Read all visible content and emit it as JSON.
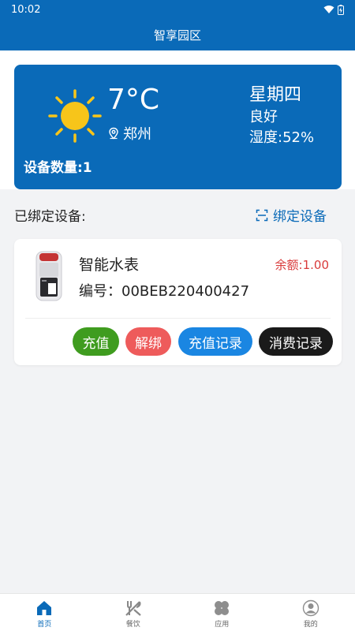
{
  "status_bar": {
    "time": "10:02"
  },
  "header": {
    "title": "智享园区"
  },
  "weather": {
    "temperature": "7°C",
    "city": "郑州",
    "weekday": "星期四",
    "condition": "良好",
    "humidity": "湿度:52%",
    "device_count": "设备数量:1",
    "card_color": "#0a6ab8"
  },
  "devices_section": {
    "label": "已绑定设备:",
    "bind_link": "绑定设备"
  },
  "device": {
    "name": "智能水表",
    "number": "编号：00BEB220400427",
    "balance": "余额:1.00",
    "actions": {
      "recharge": "充值",
      "unbind": "解绑",
      "recharge_log": "充值记录",
      "consume_log": "消费记录"
    }
  },
  "tabs": [
    {
      "label": "首页",
      "icon": "home-icon",
      "active": true
    },
    {
      "label": "餐饮",
      "icon": "utensils-icon",
      "active": false
    },
    {
      "label": "应用",
      "icon": "apps-icon",
      "active": false
    },
    {
      "label": "我的",
      "icon": "user-icon",
      "active": false
    }
  ],
  "colors": {
    "primary": "#0a6ab8",
    "recharge_btn": "#3f9c1f",
    "unbind_btn": "#ee5b5b",
    "recharge_log_btn": "#1a86e2",
    "consume_log_btn": "#1a1a1a",
    "balance_text": "#d93a3a"
  }
}
